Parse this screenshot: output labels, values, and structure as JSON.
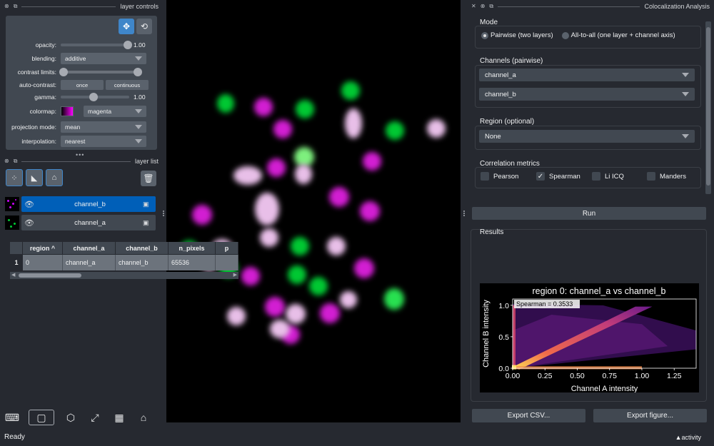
{
  "left_dock": {
    "layer_controls": {
      "title": "layer controls",
      "opacity": {
        "label": "opacity:",
        "value": "1.00",
        "level": 1.0
      },
      "blending": {
        "label": "blending:",
        "value": "additive"
      },
      "contrast_limits": {
        "label": "contrast limits:"
      },
      "auto_contrast": {
        "label": "auto-contrast:",
        "once": "once",
        "continuous": "continuous"
      },
      "gamma": {
        "label": "gamma:",
        "value": "1.00",
        "level": 0.45
      },
      "colormap": {
        "label": "colormap:",
        "value": "magenta"
      },
      "projection_mode": {
        "label": "projection mode:",
        "value": "mean"
      },
      "interpolation": {
        "label": "interpolation:",
        "value": "nearest"
      }
    },
    "layer_list": {
      "title": "layer list",
      "layers": [
        {
          "name": "channel_b",
          "selected": true
        },
        {
          "name": "channel_a",
          "selected": false
        }
      ]
    }
  },
  "colocalization": {
    "title": "Colocalization Analysis",
    "mode": {
      "title": "Mode",
      "pairwise": "Pairwise (two layers)",
      "all_to_all": "All-to-all (one layer + channel axis)"
    },
    "channels": {
      "title": "Channels (pairwise)",
      "a": "channel_a",
      "b": "channel_b"
    },
    "region": {
      "title": "Region (optional)",
      "value": "None"
    },
    "metrics": {
      "title": "Correlation metrics",
      "pearson": "Pearson",
      "spearman": "Spearman",
      "li_icq": "Li ICQ",
      "manders": "Manders"
    },
    "run": "Run",
    "results": {
      "title": "Results",
      "columns": [
        "region ^",
        "channel_a",
        "channel_b",
        "n_pixels",
        "p"
      ],
      "row_number": "1",
      "row": [
        "0",
        "channel_a",
        "channel_b",
        "65536",
        ""
      ]
    },
    "export_csv": "Export CSV...",
    "export_figure": "Export figure..."
  },
  "chart_data": {
    "type": "heatmap",
    "title": "region 0: channel_a vs channel_b",
    "xlabel": "Channel A intensity",
    "ylabel": "Channel B intensity",
    "x_ticks": [
      "0.00",
      "0.25",
      "0.50",
      "0.75",
      "1.00",
      "1.25"
    ],
    "y_ticks": [
      "0.0",
      "0.5",
      "1.0"
    ],
    "xlim": [
      0,
      1.42
    ],
    "ylim": [
      0,
      1.1
    ],
    "annotation": "Spearman = 0.3533"
  },
  "status": {
    "text": "Ready",
    "activity": "activity"
  }
}
